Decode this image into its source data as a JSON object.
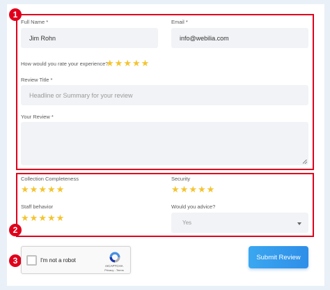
{
  "markers": [
    "1",
    "2",
    "3"
  ],
  "review_form": {
    "full_name": {
      "label": "Full Name",
      "required_mark": " *",
      "value": "Jim Rohn"
    },
    "email": {
      "label": "Email",
      "required_mark": " *",
      "value": "info@webilia.com"
    },
    "experience": {
      "label": "How would you rate your experience?",
      "rating": 5
    },
    "review_title": {
      "label": "Review Title",
      "required_mark": " *",
      "placeholder": "Headline or Summary for your review"
    },
    "your_review": {
      "label": "Your Review",
      "required_mark": " *",
      "value": ""
    }
  },
  "criteria": {
    "collection_completeness": {
      "label": "Collection Completeness",
      "rating": 5
    },
    "security": {
      "label": "Security",
      "rating": 5
    },
    "staff_behavior": {
      "label": "Staff behavior",
      "rating": 5
    },
    "advice": {
      "label": "Would you advice?",
      "selected": "Yes"
    }
  },
  "captcha": {
    "label": "I'm not a robot",
    "brand": "reCAPTCHA",
    "terms": "Privacy - Terms"
  },
  "submit": {
    "label": "Submit Review"
  },
  "colors": {
    "highlight": "#e0001b",
    "star": "#f4c430",
    "button": "#3aa7f0",
    "field_bg": "#f1f3f6"
  },
  "star_glyph": "★"
}
